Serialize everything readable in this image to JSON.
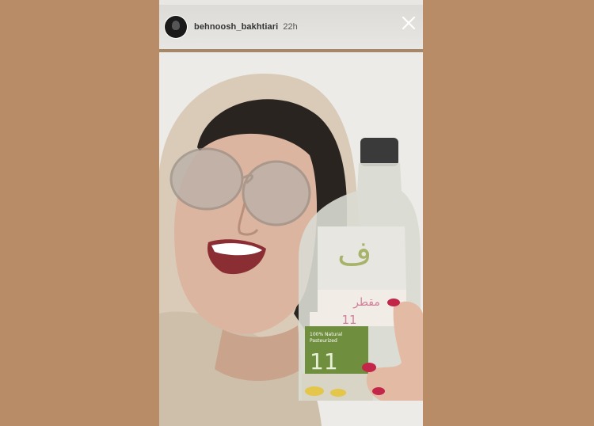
{
  "story": {
    "username": "behnoosh_bakhtiari",
    "time_ago": "22h",
    "progress": 1.0
  },
  "icons": {
    "avatar": "profile-avatar",
    "close": "close-icon"
  },
  "bottle_label": {
    "line1": "مقطر",
    "line2": "11",
    "percent_text": "100% Natural",
    "percent_sub": "Pasteurized",
    "big_number": "11"
  },
  "colors": {
    "background": "#b78c66",
    "label_green": "#6f8f3e"
  }
}
